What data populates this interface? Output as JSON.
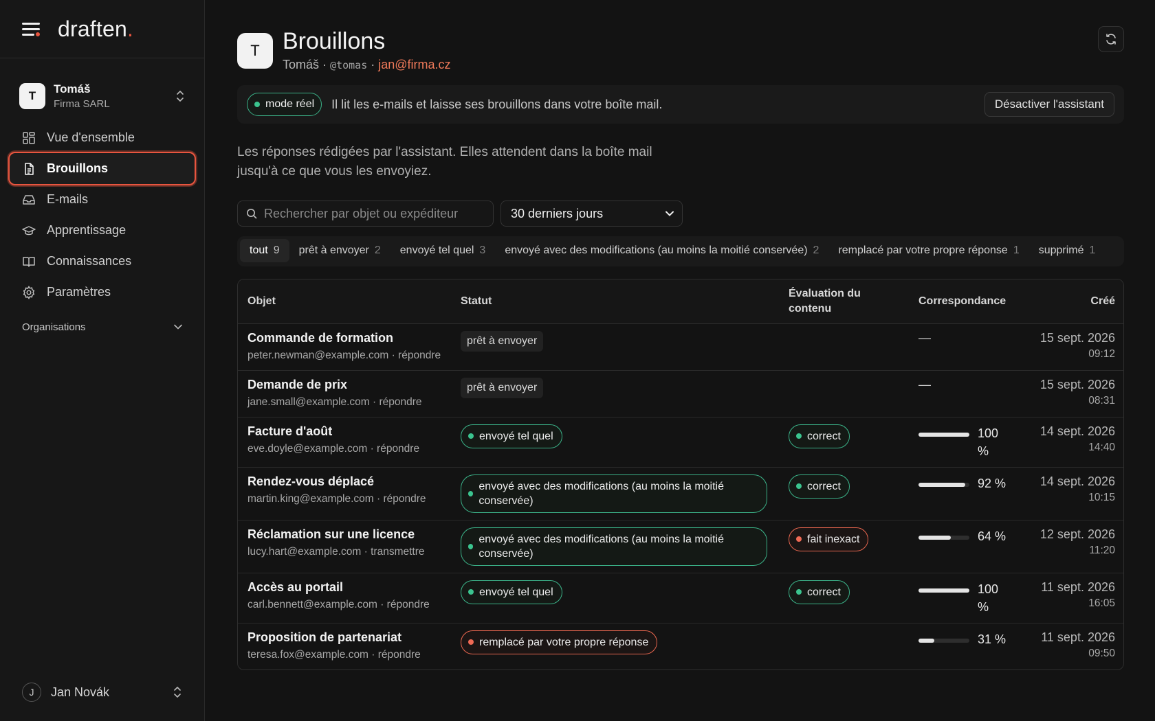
{
  "app": {
    "logo_text": "draften",
    "logo_dot": "."
  },
  "workspace": {
    "avatar": "T",
    "name": "Tomáš",
    "company": "Firma SARL"
  },
  "nav": [
    {
      "label": "Vue d'ensemble",
      "icon": "grid-icon"
    },
    {
      "label": "Brouillons",
      "icon": "document-icon",
      "active": true
    },
    {
      "label": "E-mails",
      "icon": "inbox-icon"
    },
    {
      "label": "Apprentissage",
      "icon": "graduation-cap-icon"
    },
    {
      "label": "Connaissances",
      "icon": "book-icon"
    },
    {
      "label": "Paramètres",
      "icon": "gear-icon"
    }
  ],
  "organisations_label": "Organisations",
  "user": {
    "avatar": "J",
    "name": "Jan Novák"
  },
  "page": {
    "avatar": "T",
    "title": "Brouillons",
    "owner": "Tomáš",
    "sep": "·",
    "handle": "@tomas",
    "email": "jan@firma.cz"
  },
  "banner": {
    "mode": "mode réel",
    "text": "Il lit les e-mails et laisse ses brouillons dans votre boîte mail.",
    "button": "Désactiver l'assistant"
  },
  "description": "Les réponses rédigées par l'assistant. Elles attendent dans la boîte mail jusqu'à ce que vous les envoyiez.",
  "search": {
    "placeholder": "Rechercher par objet ou expéditeur",
    "value": ""
  },
  "period": {
    "selected": "30 derniers jours"
  },
  "tabs": [
    {
      "label": "tout",
      "count": "9",
      "active": true
    },
    {
      "label": "prêt à envoyer",
      "count": "2"
    },
    {
      "label": "envoyé tel quel",
      "count": "3"
    },
    {
      "label": "envoyé avec des modifications (au moins la moitié conservée)",
      "count": "2"
    },
    {
      "label": "remplacé par votre propre réponse",
      "count": "1"
    },
    {
      "label": "supprimé",
      "count": "1"
    }
  ],
  "columns": {
    "subject": "Objet",
    "status": "Statut",
    "eval": "Évaluation du contenu",
    "match": "Correspondance",
    "created": "Créé"
  },
  "rows": [
    {
      "subject": "Commande de formation",
      "sender": "peter.newman@example.com · répondre",
      "status": "prêt à envoyer",
      "status_type": "gray",
      "eval": "",
      "eval_type": "",
      "match": null,
      "match_text": "—",
      "date": "15 sept. 2026",
      "time": "09:12"
    },
    {
      "subject": "Demande de prix",
      "sender": "jane.small@example.com · répondre",
      "status": "prêt à envoyer",
      "status_type": "gray",
      "eval": "",
      "eval_type": "",
      "match": null,
      "match_text": "—",
      "date": "15 sept. 2026",
      "time": "08:31"
    },
    {
      "subject": "Facture d'août",
      "sender": "eve.doyle@example.com · répondre",
      "status": "envoyé tel quel",
      "status_type": "green",
      "eval": "correct",
      "eval_type": "green",
      "match": 100,
      "match_text": "100 %",
      "date": "14 sept. 2026",
      "time": "14:40"
    },
    {
      "subject": "Rendez-vous déplacé",
      "sender": "martin.king@example.com · répondre",
      "status": "envoyé avec des modifications (au moins la moitié conservée)",
      "status_type": "green-wide",
      "eval": "correct",
      "eval_type": "green",
      "match": 92,
      "match_text": "92 %",
      "date": "14 sept. 2026",
      "time": "10:15"
    },
    {
      "subject": "Réclamation sur une licence",
      "sender": "lucy.hart@example.com · transmettre",
      "status": "envoyé avec des modifications (au moins la moitié conservée)",
      "status_type": "green-wide",
      "eval": "fait inexact",
      "eval_type": "red",
      "match": 64,
      "match_text": "64 %",
      "date": "12 sept. 2026",
      "time": "11:20"
    },
    {
      "subject": "Accès au portail",
      "sender": "carl.bennett@example.com · répondre",
      "status": "envoyé tel quel",
      "status_type": "green",
      "eval": "correct",
      "eval_type": "green",
      "match": 100,
      "match_text": "100 %",
      "date": "11 sept. 2026",
      "time": "16:05"
    },
    {
      "subject": "Proposition de partenariat",
      "sender": "teresa.fox@example.com · répondre",
      "status": "remplacé par votre propre réponse",
      "status_type": "red",
      "eval": "",
      "eval_type": "",
      "match": 31,
      "match_text": "31 %",
      "date": "11 sept. 2026",
      "time": "09:50"
    }
  ],
  "colors": {
    "accent": "#e8553f",
    "green": "#3bb389",
    "red": "#e8664f"
  }
}
